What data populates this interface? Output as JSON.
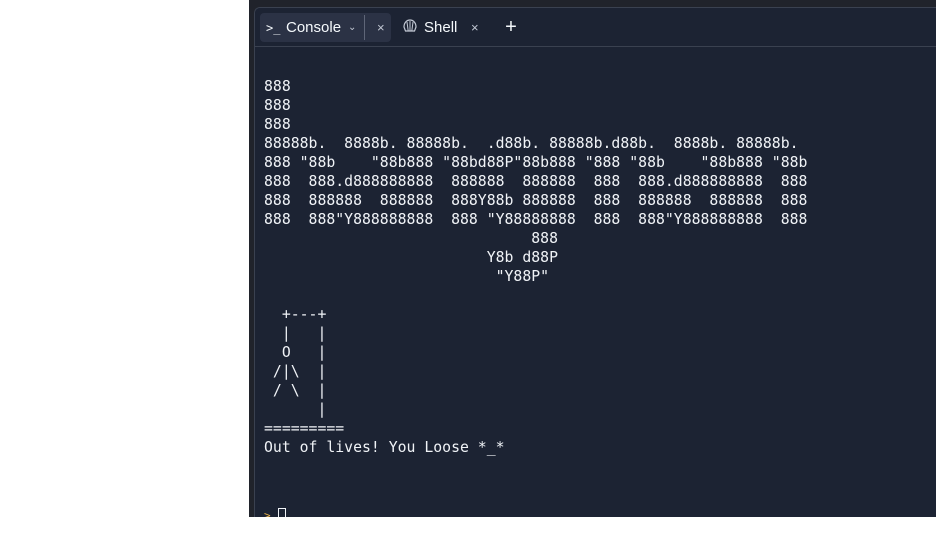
{
  "tabs": [
    {
      "label": "Console",
      "prompt_icon": ">_",
      "chevron": "⌄",
      "close": "×"
    },
    {
      "label": "Shell",
      "close": "×"
    }
  ],
  "add_tab": "+",
  "console": {
    "ascii_lines": [
      "888",
      "888",
      "888",
      "88888b.  8888b. 88888b.  .d88b. 88888b.d88b.  8888b. 88888b.",
      "888 \"88b    \"88b888 \"88bd88P\"88b888 \"888 \"88b    \"88b888 \"88b",
      "888  888.d888888888  888888  888888  888  888.d888888888  888",
      "888  888888  888888  888Y88b 888888  888  888888  888888  888",
      "888  888\"Y888888888  888 \"Y88888888  888  888\"Y888888888  888",
      "                              888",
      "                         Y8b d88P",
      "                          \"Y88P\"",
      "",
      "  +---+",
      "  |   |",
      "  O   |",
      " /|\\  |",
      " / \\  |",
      "      |",
      "=========",
      "Out of lives! You Loose *_*"
    ],
    "input_prompt": ">",
    "input_value": ""
  }
}
